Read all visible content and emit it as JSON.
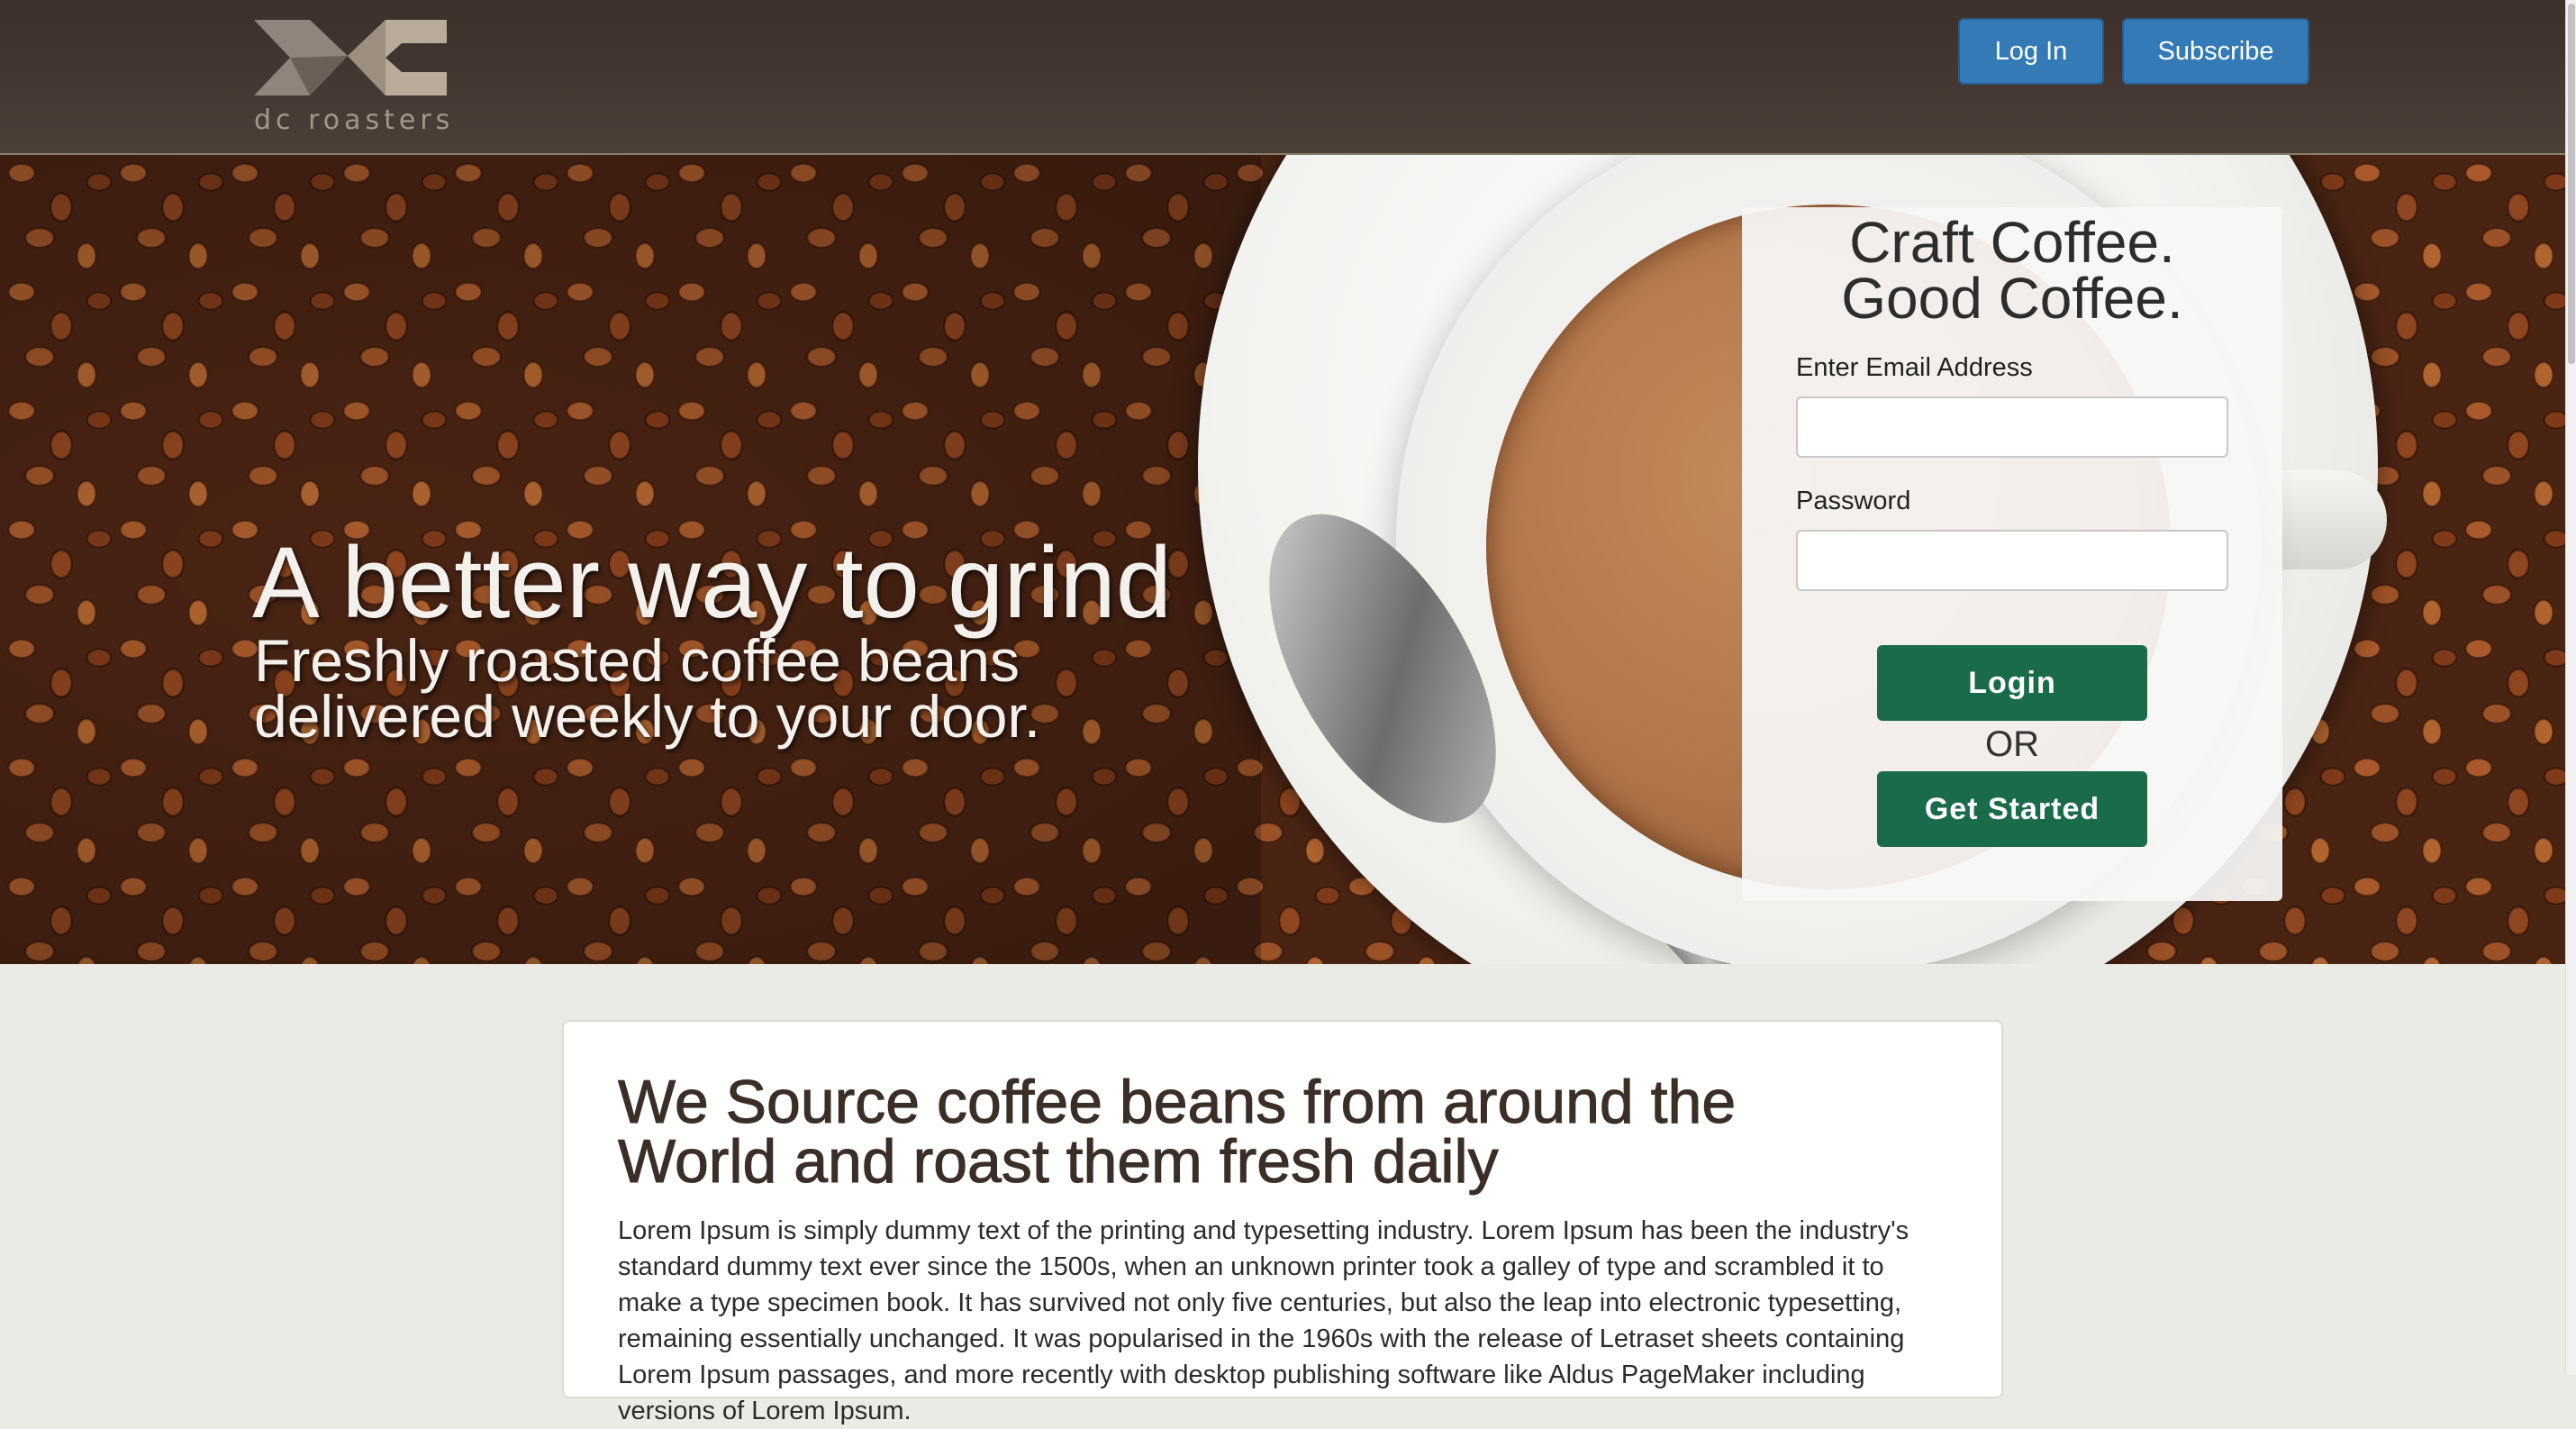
{
  "header": {
    "logo": {
      "icon": "dc-roasters-logo-icon",
      "text": "dc roasters"
    },
    "login_button": "Log In",
    "subscribe_button": "Subscribe"
  },
  "hero": {
    "title": "A better way to grind",
    "subtitle": "Freshly roasted coffee beans delivered weekly to your door."
  },
  "login_card": {
    "headline_line1": "Craft Coffee.",
    "headline_line2": "Good Coffee.",
    "email_label": "Enter Email Address",
    "email_value": "",
    "password_label": "Password",
    "password_value": "",
    "login_button": "Login",
    "or_text": "OR",
    "get_started_button": "Get Started"
  },
  "content": {
    "heading_line1": "We Source coffee beans from around the",
    "heading_line2": "World and roast them fresh daily",
    "body": "Lorem Ipsum is simply dummy text of the printing and typesetting industry. Lorem Ipsum has been the industry's standard dummy text ever since the 1500s, when an unknown printer took a galley of type and scrambled it to make a type specimen book. It has survived not only five centuries, but also the leap into electronic typesetting, remaining essentially unchanged. It was popularised in the 1960s with the release of Letraset sheets containing Lorem Ipsum passages, and more recently with desktop publishing software like Aldus PageMaker including versions of Lorem Ipsum."
  },
  "colors": {
    "header_bg": "#3b302a",
    "nav_button": "#337ab7",
    "cta_green": "#1a6b49",
    "page_bg": "#eceae4",
    "heading_text": "#3a2e27"
  }
}
